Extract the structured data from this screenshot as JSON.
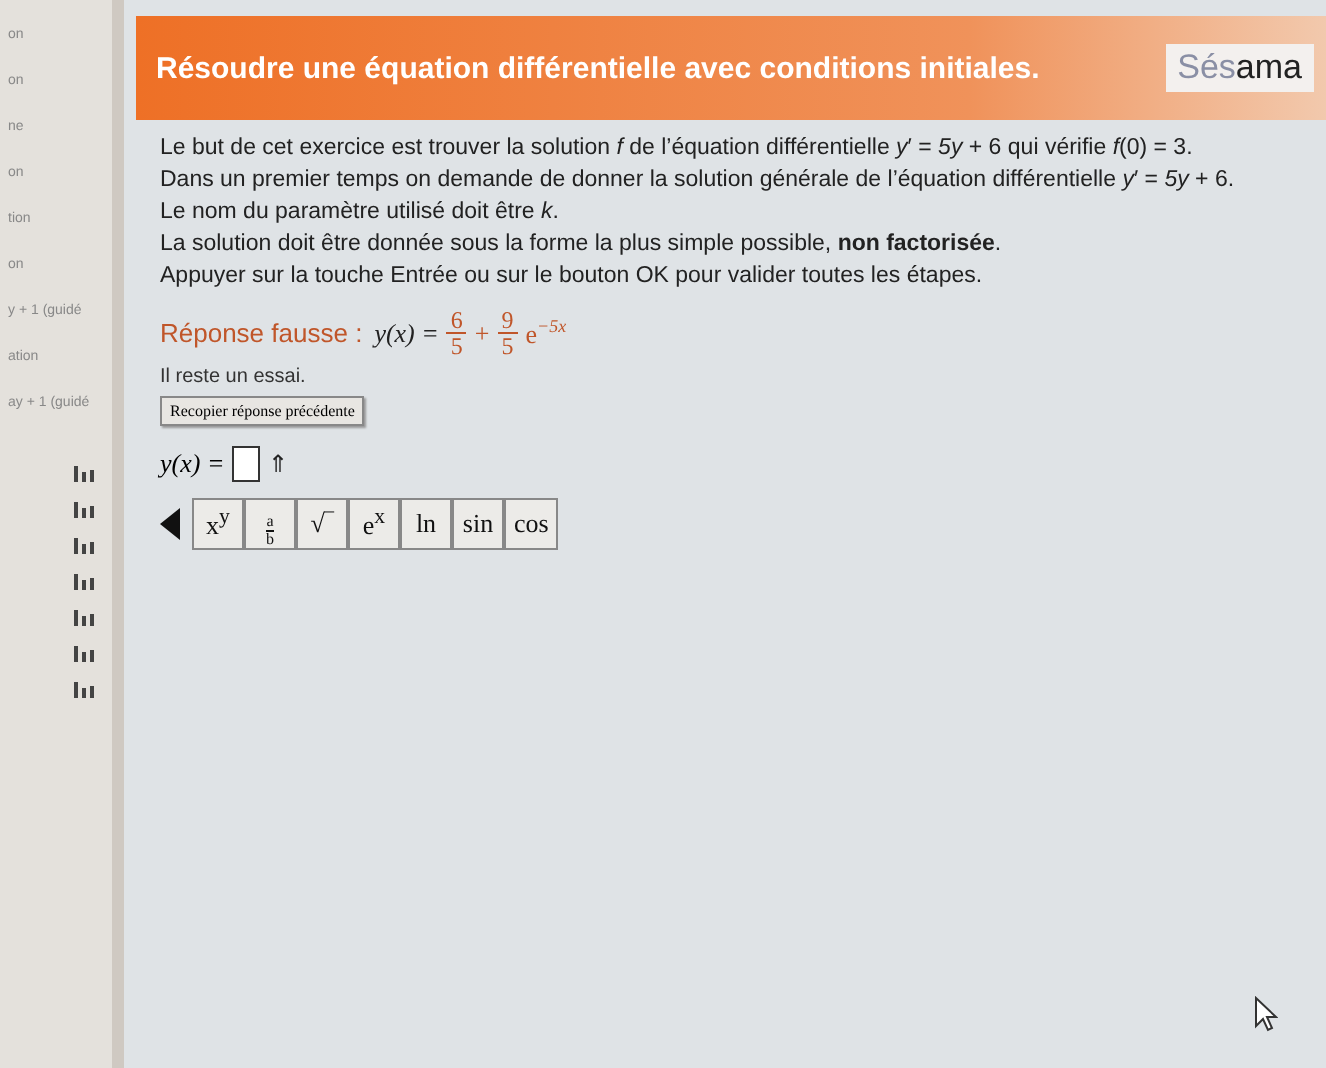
{
  "sidebar": {
    "items": [
      "on",
      "on",
      "ne",
      "on",
      "tion",
      "on",
      "y + 1 (guidé",
      "ation",
      "ay + 1 (guidé"
    ]
  },
  "header": {
    "title": "Résoudre une équation différentielle avec conditions initiales.",
    "logo_left": "Sés",
    "logo_right": "ama"
  },
  "instructions": [
    "Le but de cet exercice est trouver la solution *f* de l’équation différentielle *y*′ = *5y* + 6 qui vérifie *f*(0) = 3.",
    "Dans un premier temps on demande de donner la solution générale de l’équation différentielle *y*′ = *5y* + 6.",
    "Le nom du paramètre utilisé doit être *k*.",
    "La solution doit être donnée sous la forme la plus simple possible, **non factorisée**.",
    "Appuyer sur la touche Entrée ou sur le bouton OK pour valider toutes les étapes."
  ],
  "feedback": {
    "label": "Réponse fausse :",
    "lhs": "y(x) =",
    "terms": [
      {
        "num": "6",
        "den": "5"
      },
      {
        "op": "+",
        "num": "9",
        "den": "5",
        "base": "e",
        "exp": "−5x"
      }
    ]
  },
  "remaining": "Il reste un essai.",
  "copy_button": "Recopier réponse précédente",
  "input": {
    "label": "y(x) =",
    "arrow": "⇑"
  },
  "keys": [
    {
      "kind": "text",
      "label": "x$^{y}$"
    },
    {
      "kind": "fraction",
      "num": "a",
      "den": "b"
    },
    {
      "kind": "text",
      "label": "√‾"
    },
    {
      "kind": "text",
      "label": "e$^{x}$"
    },
    {
      "kind": "text",
      "label": "ln"
    },
    {
      "kind": "text",
      "label": "sin"
    },
    {
      "kind": "text",
      "label": "cos"
    }
  ]
}
